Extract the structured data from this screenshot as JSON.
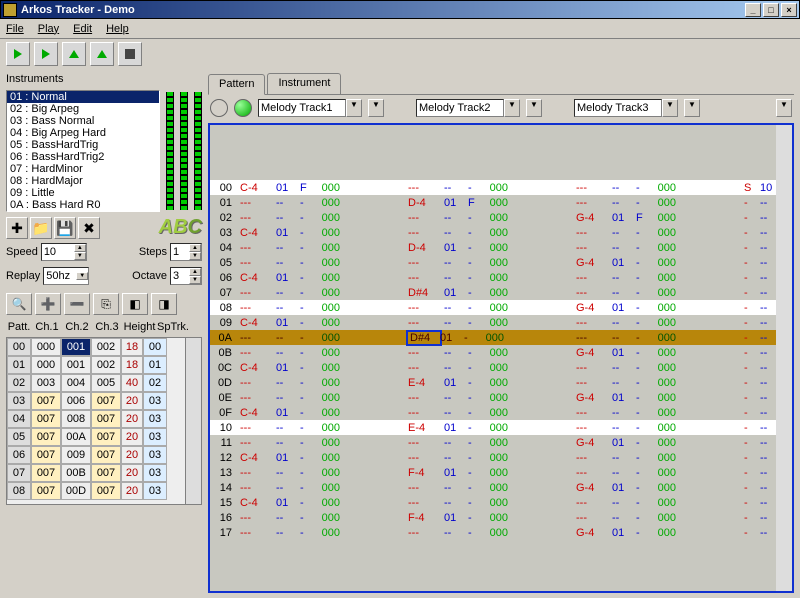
{
  "window": {
    "title": "Arkos Tracker - Demo"
  },
  "menu": [
    "File",
    "Play",
    "Edit",
    "Help"
  ],
  "left": {
    "instruments_label": "Instruments",
    "instruments": [
      "01 : Normal",
      "02 : Big Arpeg",
      "03 : Bass Normal",
      "04 : Big Arpeg Hard",
      "05 : BassHardTrig",
      "06 : BassHardTrig2",
      "07 : HardMinor",
      "08 : HardMajor",
      "09 : Little",
      "0A : Bass Hard R0"
    ],
    "abc": [
      "A",
      "B",
      "C"
    ],
    "abc_colors": [
      "#a0cc40",
      "#a0cc40",
      "#70a030"
    ],
    "speed_label": "Speed",
    "speed_value": "10",
    "replay_label": "Replay",
    "replay_value": "50hz",
    "steps_label": "Steps",
    "steps_value": "1",
    "octave_label": "Octave",
    "octave_value": "3",
    "pat_headers": [
      "Patt.",
      "Ch.1",
      "Ch.2",
      "Ch.3",
      "Height",
      "SpTrk."
    ],
    "pat_rows": [
      [
        "00",
        "000",
        "001",
        "002",
        "18",
        "00"
      ],
      [
        "01",
        "000",
        "001",
        "002",
        "18",
        "01"
      ],
      [
        "02",
        "003",
        "004",
        "005",
        "40",
        "02"
      ],
      [
        "03",
        "007",
        "006",
        "007",
        "20",
        "03"
      ],
      [
        "04",
        "007",
        "008",
        "007",
        "20",
        "03"
      ],
      [
        "05",
        "007",
        "00A",
        "007",
        "20",
        "03"
      ],
      [
        "06",
        "007",
        "009",
        "007",
        "20",
        "03"
      ],
      [
        "07",
        "007",
        "00B",
        "007",
        "20",
        "03"
      ],
      [
        "08",
        "007",
        "00D",
        "007",
        "20",
        "03"
      ]
    ]
  },
  "tabs": {
    "pattern": "Pattern",
    "instrument": "Instrument"
  },
  "tracks": {
    "t1": "Melody Track1",
    "t2": "Melody Track2",
    "t3": "Melody Track3"
  },
  "rows": [
    {
      "i": "00",
      "s": true,
      "t1": [
        "C-4",
        "01",
        "F",
        "000"
      ],
      "t2": [
        "---",
        "--",
        "-",
        "000"
      ],
      "t3": [
        "---",
        "--",
        "-",
        "000"
      ],
      "sp": [
        "S",
        "10"
      ]
    },
    {
      "i": "01",
      "t1": [
        "---",
        "--",
        "-",
        "000"
      ],
      "t2": [
        "D-4",
        "01",
        "F",
        "000"
      ],
      "t3": [
        "---",
        "--",
        "-",
        "000"
      ],
      "sp": [
        "-",
        "--"
      ]
    },
    {
      "i": "02",
      "t1": [
        "---",
        "--",
        "-",
        "000"
      ],
      "t2": [
        "---",
        "--",
        "-",
        "000"
      ],
      "t3": [
        "G-4",
        "01",
        "F",
        "000"
      ],
      "sp": [
        "-",
        "--"
      ]
    },
    {
      "i": "03",
      "t1": [
        "C-4",
        "01",
        "-",
        "000"
      ],
      "t2": [
        "---",
        "--",
        "-",
        "000"
      ],
      "t3": [
        "---",
        "--",
        "-",
        "000"
      ],
      "sp": [
        "-",
        "--"
      ]
    },
    {
      "i": "04",
      "t1": [
        "---",
        "--",
        "-",
        "000"
      ],
      "t2": [
        "D-4",
        "01",
        "-",
        "000"
      ],
      "t3": [
        "---",
        "--",
        "-",
        "000"
      ],
      "sp": [
        "-",
        "--"
      ]
    },
    {
      "i": "05",
      "t1": [
        "---",
        "--",
        "-",
        "000"
      ],
      "t2": [
        "---",
        "--",
        "-",
        "000"
      ],
      "t3": [
        "G-4",
        "01",
        "-",
        "000"
      ],
      "sp": [
        "-",
        "--"
      ]
    },
    {
      "i": "06",
      "t1": [
        "C-4",
        "01",
        "-",
        "000"
      ],
      "t2": [
        "---",
        "--",
        "-",
        "000"
      ],
      "t3": [
        "---",
        "--",
        "-",
        "000"
      ],
      "sp": [
        "-",
        "--"
      ]
    },
    {
      "i": "07",
      "t1": [
        "---",
        "--",
        "-",
        "000"
      ],
      "t2": [
        "D#4",
        "01",
        "-",
        "000"
      ],
      "t3": [
        "---",
        "--",
        "-",
        "000"
      ],
      "sp": [
        "-",
        "--"
      ]
    },
    {
      "i": "08",
      "s": true,
      "t1": [
        "---",
        "--",
        "-",
        "000"
      ],
      "t2": [
        "---",
        "--",
        "-",
        "000"
      ],
      "t3": [
        "G-4",
        "01",
        "-",
        "000"
      ],
      "sp": [
        "-",
        "--"
      ]
    },
    {
      "i": "09",
      "t1": [
        "C-4",
        "01",
        "-",
        "000"
      ],
      "t2": [
        "---",
        "--",
        "-",
        "000"
      ],
      "t3": [
        "---",
        "--",
        "-",
        "000"
      ],
      "sp": [
        "-",
        "--"
      ]
    },
    {
      "i": "0A",
      "cur": true,
      "t1": [
        "---",
        "--",
        "-",
        "000"
      ],
      "t2": [
        "D#4",
        "01",
        "-",
        "000"
      ],
      "t3": [
        "---",
        "--",
        "-",
        "000"
      ],
      "sp": [
        "-",
        "--"
      ]
    },
    {
      "i": "0B",
      "t1": [
        "---",
        "--",
        "-",
        "000"
      ],
      "t2": [
        "---",
        "--",
        "-",
        "000"
      ],
      "t3": [
        "G-4",
        "01",
        "-",
        "000"
      ],
      "sp": [
        "-",
        "--"
      ]
    },
    {
      "i": "0C",
      "t1": [
        "C-4",
        "01",
        "-",
        "000"
      ],
      "t2": [
        "---",
        "--",
        "-",
        "000"
      ],
      "t3": [
        "---",
        "--",
        "-",
        "000"
      ],
      "sp": [
        "-",
        "--"
      ]
    },
    {
      "i": "0D",
      "t1": [
        "---",
        "--",
        "-",
        "000"
      ],
      "t2": [
        "E-4",
        "01",
        "-",
        "000"
      ],
      "t3": [
        "---",
        "--",
        "-",
        "000"
      ],
      "sp": [
        "-",
        "--"
      ]
    },
    {
      "i": "0E",
      "t1": [
        "---",
        "--",
        "-",
        "000"
      ],
      "t2": [
        "---",
        "--",
        "-",
        "000"
      ],
      "t3": [
        "G-4",
        "01",
        "-",
        "000"
      ],
      "sp": [
        "-",
        "--"
      ]
    },
    {
      "i": "0F",
      "t1": [
        "C-4",
        "01",
        "-",
        "000"
      ],
      "t2": [
        "---",
        "--",
        "-",
        "000"
      ],
      "t3": [
        "---",
        "--",
        "-",
        "000"
      ],
      "sp": [
        "-",
        "--"
      ]
    },
    {
      "i": "10",
      "s": true,
      "t1": [
        "---",
        "--",
        "-",
        "000"
      ],
      "t2": [
        "E-4",
        "01",
        "-",
        "000"
      ],
      "t3": [
        "---",
        "--",
        "-",
        "000"
      ],
      "sp": [
        "-",
        "--"
      ]
    },
    {
      "i": "11",
      "t1": [
        "---",
        "--",
        "-",
        "000"
      ],
      "t2": [
        "---",
        "--",
        "-",
        "000"
      ],
      "t3": [
        "G-4",
        "01",
        "-",
        "000"
      ],
      "sp": [
        "-",
        "--"
      ]
    },
    {
      "i": "12",
      "t1": [
        "C-4",
        "01",
        "-",
        "000"
      ],
      "t2": [
        "---",
        "--",
        "-",
        "000"
      ],
      "t3": [
        "---",
        "--",
        "-",
        "000"
      ],
      "sp": [
        "-",
        "--"
      ]
    },
    {
      "i": "13",
      "t1": [
        "---",
        "--",
        "-",
        "000"
      ],
      "t2": [
        "F-4",
        "01",
        "-",
        "000"
      ],
      "t3": [
        "---",
        "--",
        "-",
        "000"
      ],
      "sp": [
        "-",
        "--"
      ]
    },
    {
      "i": "14",
      "t1": [
        "---",
        "--",
        "-",
        "000"
      ],
      "t2": [
        "---",
        "--",
        "-",
        "000"
      ],
      "t3": [
        "G-4",
        "01",
        "-",
        "000"
      ],
      "sp": [
        "-",
        "--"
      ]
    },
    {
      "i": "15",
      "t1": [
        "C-4",
        "01",
        "-",
        "000"
      ],
      "t2": [
        "---",
        "--",
        "-",
        "000"
      ],
      "t3": [
        "---",
        "--",
        "-",
        "000"
      ],
      "sp": [
        "-",
        "--"
      ]
    },
    {
      "i": "16",
      "t1": [
        "---",
        "--",
        "-",
        "000"
      ],
      "t2": [
        "F-4",
        "01",
        "-",
        "000"
      ],
      "t3": [
        "---",
        "--",
        "-",
        "000"
      ],
      "sp": [
        "-",
        "--"
      ]
    },
    {
      "i": "17",
      "t1": [
        "---",
        "--",
        "-",
        "000"
      ],
      "t2": [
        "---",
        "--",
        "-",
        "000"
      ],
      "t3": [
        "G-4",
        "01",
        "-",
        "000"
      ],
      "sp": [
        "-",
        "--"
      ]
    }
  ]
}
